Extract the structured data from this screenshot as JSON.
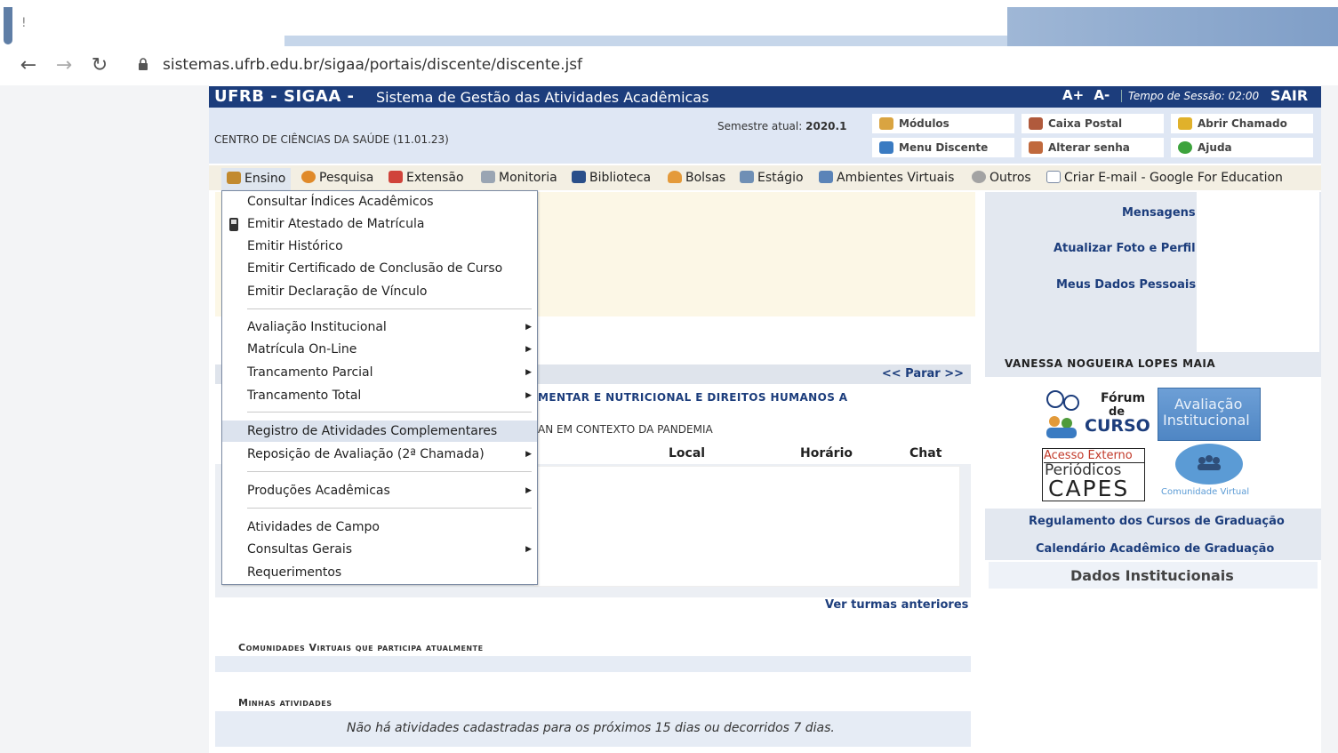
{
  "browser": {
    "tab_title": "!",
    "url": "sistemas.ufrb.edu.br/sigaa/portais/discente/discente.jsf"
  },
  "header": {
    "brand": "UFRB - SIGAA -",
    "subtitle": "Sistema de Gestão das Atividades Acadêmicas",
    "font_increase": "A+",
    "font_decrease": "A-",
    "session_label": "Tempo de Sessão: 02:00",
    "logout": "SAIR"
  },
  "info": {
    "centro": "CENTRO DE CIÊNCIAS DA SAÚDE (11.01.23)",
    "semestre_label": "Semestre atual:",
    "semestre_value": "2020.1",
    "quick_links": [
      "Módulos",
      "Caixa Postal",
      "Abrir Chamado",
      "Menu Discente",
      "Alterar senha",
      "Ajuda"
    ]
  },
  "menu": {
    "items": [
      "Ensino",
      "Pesquisa",
      "Extensão",
      "Monitoria",
      "Biblioteca",
      "Bolsas",
      "Estágio",
      "Ambientes Virtuais",
      "Outros",
      "Criar E-mail - Google For Education"
    ]
  },
  "dropdown": {
    "items": [
      "Consultar Índices Acadêmicos",
      "Emitir Atestado de Matrícula",
      "Emitir Histórico",
      "Emitir Certificado de Conclusão de Curso",
      "Emitir Declaração de Vínculo",
      "Avaliação Institucional",
      "Matrícula On-Line",
      "Trancamento Parcial",
      "Trancamento Total",
      "Registro de Atividades Complementares",
      "Reposição de Avaliação (2ª Chamada)",
      "Produções Acadêmicas",
      "Atividades de Campo",
      "Consultas Gerais",
      "Requerimentos"
    ]
  },
  "main": {
    "parar": "<< Parar >>",
    "turma_title": "MENTAR E NUTRICIONAL E DIREITOS HUMANOS A",
    "turma_sub": "AN EM CONTEXTO DA PANDEMIA",
    "col_local": "Local",
    "col_horario": "Horário",
    "col_chat": "Chat",
    "ver_turmas": "Ver turmas anteriores",
    "comunidades_head": "Comunidades Virtuais que participa atualmente",
    "atividades_head": "Minhas atividades",
    "atividades_msg": "Não há atividades cadastradas para os próximos 15 dias ou decorridos 7 dias."
  },
  "sidebar": {
    "mensagens": "Mensagens",
    "atualizar_foto": "Atualizar Foto e Perfil",
    "dados_pessoais": "Meus Dados Pessoais",
    "student_name": "VANESSA NOGUEIRA LOPES MAIA",
    "tile_forum_1": "Fórum",
    "tile_forum_2": "de",
    "tile_forum_3": "CURSO",
    "tile_aval_1": "Avaliação",
    "tile_aval_2": "Institucional",
    "tile_capes_1": "Acesso Externo",
    "tile_capes_2": "Periódicos",
    "tile_capes_3": "CAPES",
    "tile_comunidade": "Comunidade Virtual",
    "regulamento": "Regulamento dos Cursos de Graduação",
    "calendario": "Calendário Acadêmico de Graduação",
    "dados_institucionais": "Dados Institucionais"
  }
}
